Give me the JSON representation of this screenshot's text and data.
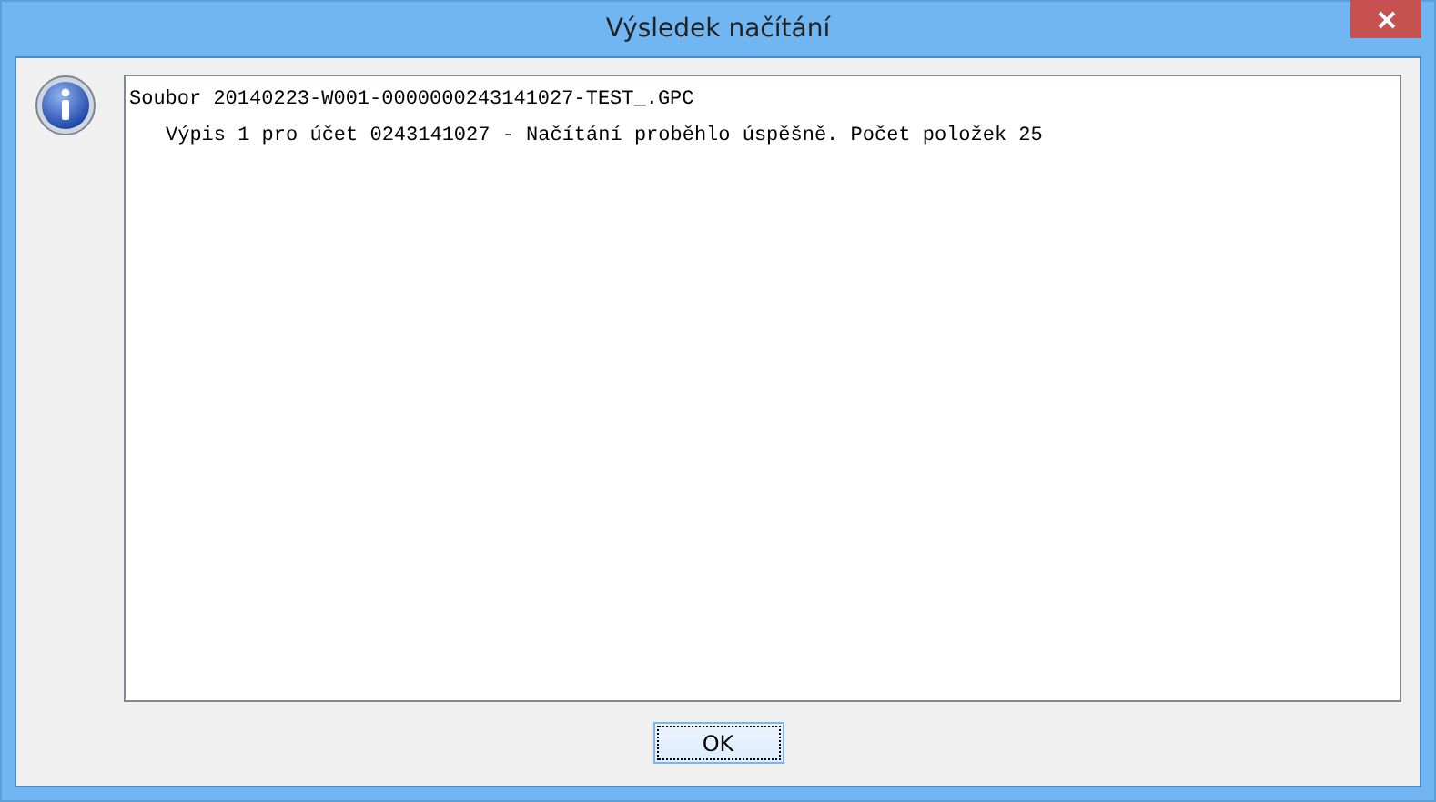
{
  "window": {
    "title": "Výsledek načítání"
  },
  "log_lines": [
    {
      "text": "Soubor 20140223-W001-0000000243141027-TEST_.GPC",
      "children": [
        {
          "text": "Výpis 1 pro účet 0243141027 - Načítání proběhlo úspěšně. Počet položek 25"
        }
      ]
    }
  ],
  "buttons": [
    {
      "label": "OK",
      "focused": true
    }
  ]
}
